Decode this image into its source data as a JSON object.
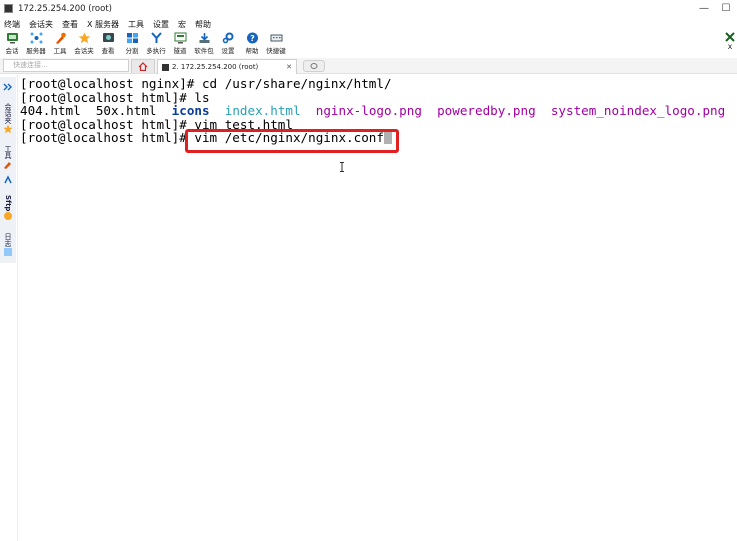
{
  "window": {
    "title": "172.25.254.200 (root)",
    "controls": [
      "—",
      "☐"
    ]
  },
  "menubar": [
    "终端",
    "会话夹",
    "查看",
    "X 服务器",
    "工具",
    "设置",
    "宏",
    "帮助"
  ],
  "toolbar": {
    "items": [
      {
        "label": "会话",
        "icon": "session-icon",
        "color": "#2e7d32"
      },
      {
        "label": "服务器",
        "icon": "servers-icon",
        "color": "#1565c0"
      },
      {
        "label": "工具",
        "icon": "tools-icon",
        "color": "#e65100"
      },
      {
        "label": "会话夹",
        "icon": "star-icon",
        "color": "#f9a825"
      },
      {
        "label": "查看",
        "icon": "view-icon",
        "color": "#37474f"
      },
      {
        "label": "分割",
        "icon": "split-icon",
        "color": "#1565c0"
      },
      {
        "label": "多执行",
        "icon": "multiexec-icon",
        "color": "#1565c0"
      },
      {
        "label": "隧道",
        "icon": "tunnel-icon",
        "color": "#2e7d32"
      },
      {
        "label": "软件包",
        "icon": "packages-icon",
        "color": "#455a64"
      },
      {
        "label": "设置",
        "icon": "gear-icon",
        "color": "#1565c0"
      },
      {
        "label": "帮助",
        "icon": "help-icon",
        "color": "#1565c0"
      },
      {
        "label": "快捷键",
        "icon": "keyboard-icon",
        "color": "#455a64"
      }
    ],
    "right_label": "X"
  },
  "address": {
    "quick_connect_placeholder": "快速连接...",
    "session_tab_label": "2. 172.25.254.200 (root)",
    "session_tab_close": "✕"
  },
  "sidebar": {
    "items": [
      {
        "label": "会话夹",
        "icon": "star-icon"
      },
      {
        "label": "工具",
        "icon": "tools-icon"
      },
      {
        "label": "Sftp",
        "icon": "sftp-icon"
      },
      {
        "label": "日志",
        "icon": "log-icon"
      }
    ]
  },
  "terminal": {
    "lines": [
      {
        "segments": [
          {
            "t": "[root@localhost nginx]# cd /usr/share/nginx/html/",
            "c": ""
          }
        ]
      },
      {
        "segments": [
          {
            "t": "[root@localhost html]# ls",
            "c": ""
          }
        ]
      },
      {
        "segments": [
          {
            "t": "404.html  50x.html  ",
            "c": ""
          },
          {
            "t": "icons",
            "c": "c-bold"
          },
          {
            "t": "  ",
            "c": ""
          },
          {
            "t": "index.html",
            "c": "c-blue"
          },
          {
            "t": "  ",
            "c": ""
          },
          {
            "t": "nginx-logo.png",
            "c": "c-purple"
          },
          {
            "t": "  ",
            "c": ""
          },
          {
            "t": "poweredby.png",
            "c": "c-purple"
          },
          {
            "t": "  ",
            "c": ""
          },
          {
            "t": "system_noindex_logo.png",
            "c": "c-purple"
          }
        ]
      },
      {
        "segments": [
          {
            "t": "[root@localhost html]# vim test.html",
            "c": ""
          }
        ]
      },
      {
        "segments": [
          {
            "t": "[root@localhost html]# vim /etc/nginx/nginx.conf",
            "c": ""
          }
        ],
        "cursor": true
      }
    ],
    "highlight_color": "#e02020"
  }
}
